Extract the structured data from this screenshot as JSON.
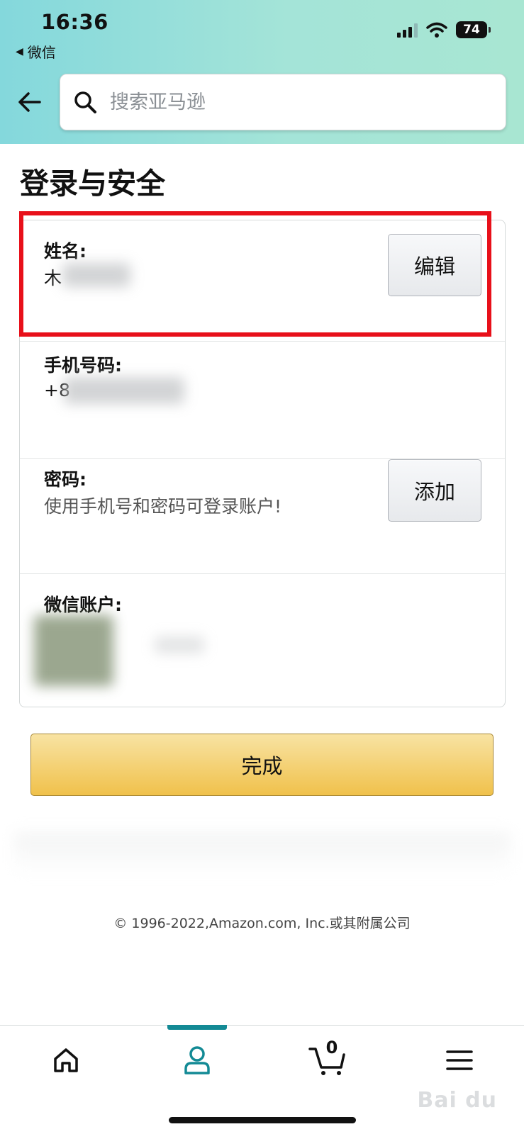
{
  "status_bar": {
    "time": "16:36",
    "back_app_label": "微信",
    "battery": "74"
  },
  "search": {
    "placeholder": "搜索亚马逊"
  },
  "page": {
    "title": "登录与安全"
  },
  "account_rows": {
    "name": {
      "label": "姓名:",
      "value_visible": "木",
      "edit_label": "编辑"
    },
    "phone": {
      "label": "手机号码:",
      "value_visible": "+8"
    },
    "password": {
      "label": "密码:",
      "description": "使用手机号和密码可登录账户!",
      "add_label": "添加"
    },
    "wechat": {
      "label": "微信账户:"
    }
  },
  "done_button": {
    "label": "完成"
  },
  "footer": {
    "copyright": "© 1996-2022,Amazon.com, Inc.或其附属公司"
  },
  "tabbar": {
    "items": [
      "home-icon",
      "account-icon",
      "cart-icon",
      "menu-icon"
    ],
    "active_index": 1,
    "cart_count": "0",
    "accent_color": "#138a95"
  },
  "colors": {
    "highlight": "#e8101a",
    "primary_button": "#f0c14b",
    "header_gradient_start": "#84d8dc",
    "header_gradient_end": "#a8e6d2"
  }
}
